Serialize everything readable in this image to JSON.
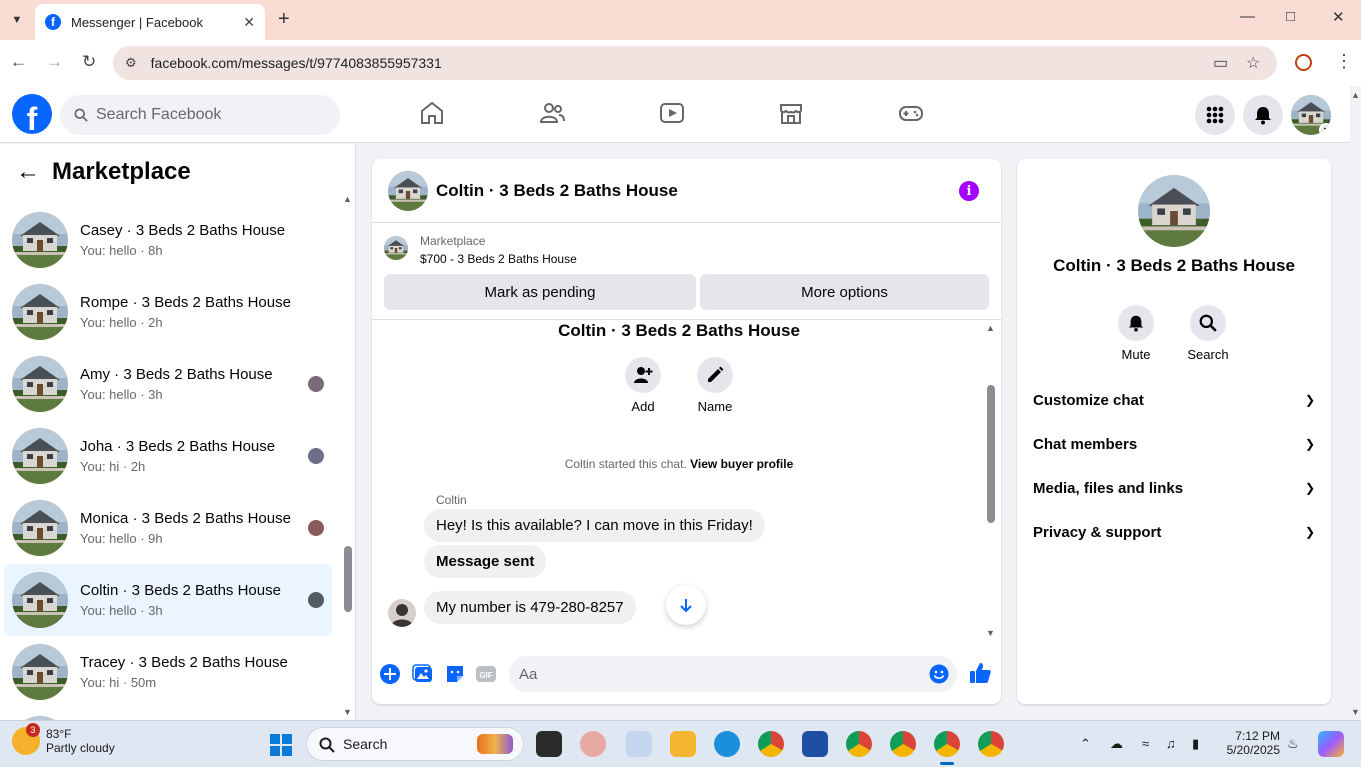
{
  "browser": {
    "tab_title": "Messenger | Facebook",
    "url": "facebook.com/messages/t/9774083855957331"
  },
  "fb": {
    "search_placeholder": "Search Facebook"
  },
  "sidebar": {
    "title": "Marketplace",
    "conversations": [
      {
        "name": "Casey · 3 Beds 2 Baths House",
        "preview": "You: hello · 8h",
        "seen_color": ""
      },
      {
        "name": "Rompe · 3 Beds 2 Baths House",
        "preview": "You: hello · 2h",
        "seen_color": ""
      },
      {
        "name": "Amy · 3 Beds 2 Baths House",
        "preview": "You: hello · 3h",
        "seen_color": "#7a6a7a"
      },
      {
        "name": "Joha · 3 Beds 2 Baths House",
        "preview": "You: hi · 2h",
        "seen_color": "#6b6f88"
      },
      {
        "name": "Monica · 3 Beds 2 Baths House",
        "preview": "You: hello · 9h",
        "seen_color": "#8a5a5a"
      },
      {
        "name": "Coltin · 3 Beds 2 Baths House",
        "preview": "You: hello · 3h",
        "seen_color": "#555a60",
        "active": true
      },
      {
        "name": "Tracey · 3 Beds 2 Baths House",
        "preview": "You: hi · 50m",
        "seen_color": ""
      }
    ]
  },
  "chat": {
    "header_name": "Coltin · 3 Beds 2 Baths House",
    "marketplace_label": "Marketplace",
    "listing": "$700 - 3 Beds 2 Baths House",
    "mark_pending": "Mark as pending",
    "more_options": "More options",
    "thread_title": "Coltin · 3 Beds 2 Baths House",
    "actions": {
      "add": "Add",
      "name": "Name"
    },
    "started_text": "Coltin started this chat.",
    "view_buyer": "View buyer profile",
    "sender": "Coltin",
    "messages": [
      "Hey! Is this available? I can move in this Friday!",
      "Message sent",
      "My number is 479-280-8257"
    ],
    "composer_placeholder": "Aa"
  },
  "info_panel": {
    "name": "Coltin · 3 Beds 2 Baths House",
    "mute": "Mute",
    "search": "Search",
    "sections": [
      "Customize chat",
      "Chat members",
      "Media, files and links",
      "Privacy & support"
    ]
  },
  "taskbar": {
    "weather_badge": "3",
    "temperature": "83°F",
    "condition": "Partly cloudy",
    "search_label": "Search",
    "time": "7:12 PM",
    "date": "5/20/2025"
  },
  "colors": {
    "fb_blue": "#0866ff",
    "info_purple": "#a200ff",
    "active_row": "#ebf5ff"
  }
}
